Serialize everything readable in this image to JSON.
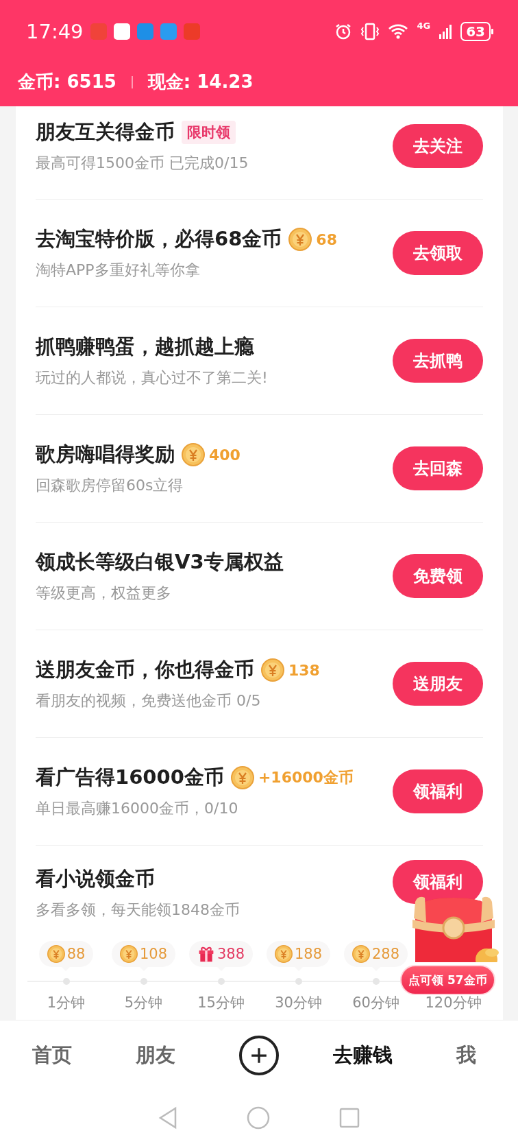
{
  "status_bar": {
    "time": "17:49",
    "network": "4G",
    "battery": "63"
  },
  "balance": {
    "coins": "金币: 6515",
    "cash": "现金: 14.23"
  },
  "tasks": [
    {
      "title": "朋友互关得金币",
      "tag": "限时领",
      "subtitle": "最高可得1500金币 已完成0/15",
      "button": "去关注"
    },
    {
      "title": "去淘宝特价版，必得68金币",
      "reward": "68",
      "subtitle": "淘特APP多重好礼等你拿",
      "button": "去领取"
    },
    {
      "title": "抓鸭赚鸭蛋，越抓越上瘾",
      "subtitle": "玩过的人都说，真心过不了第二关!",
      "button": "去抓鸭"
    },
    {
      "title": "歌房嗨唱得奖励",
      "reward": "400",
      "subtitle": "回森歌房停留60s立得",
      "button": "去回森"
    },
    {
      "title": "领成长等级白银V3专属权益",
      "subtitle": "等级更高，权益更多",
      "button": "免费领"
    },
    {
      "title": "送朋友金币，你也得金币",
      "reward": "138",
      "subtitle": "看朋友的视频，免费送他金币 0/5",
      "button": "送朋友"
    },
    {
      "title": "看广告得16000金币",
      "reward": "+16000金币",
      "subtitle": "单日最高赚16000金币，0/10",
      "button": "领福利"
    },
    {
      "title": "看小说领金币",
      "subtitle": "多看多领，每天能领1848金币",
      "button": "领福利",
      "milestones": {
        "rewards": [
          {
            "kind": "coin",
            "amount": "88"
          },
          {
            "kind": "coin",
            "amount": "108"
          },
          {
            "kind": "gift",
            "amount": "388"
          },
          {
            "kind": "coin",
            "amount": "188"
          },
          {
            "kind": "coin",
            "amount": "288"
          }
        ],
        "times": [
          "1分钟",
          "5分钟",
          "15分钟",
          "30分钟",
          "60分钟",
          "120分钟"
        ]
      }
    }
  ],
  "floating_chest": {
    "label": "点可领 57金币"
  },
  "bottom_nav": [
    {
      "kind": "tab",
      "label": "首页",
      "selected": false
    },
    {
      "kind": "tab",
      "label": "朋友",
      "selected": false
    },
    {
      "kind": "create",
      "selected": false
    },
    {
      "kind": "tab",
      "label": "去赚钱",
      "selected": true
    },
    {
      "kind": "tab",
      "label": "我",
      "selected": false
    }
  ]
}
